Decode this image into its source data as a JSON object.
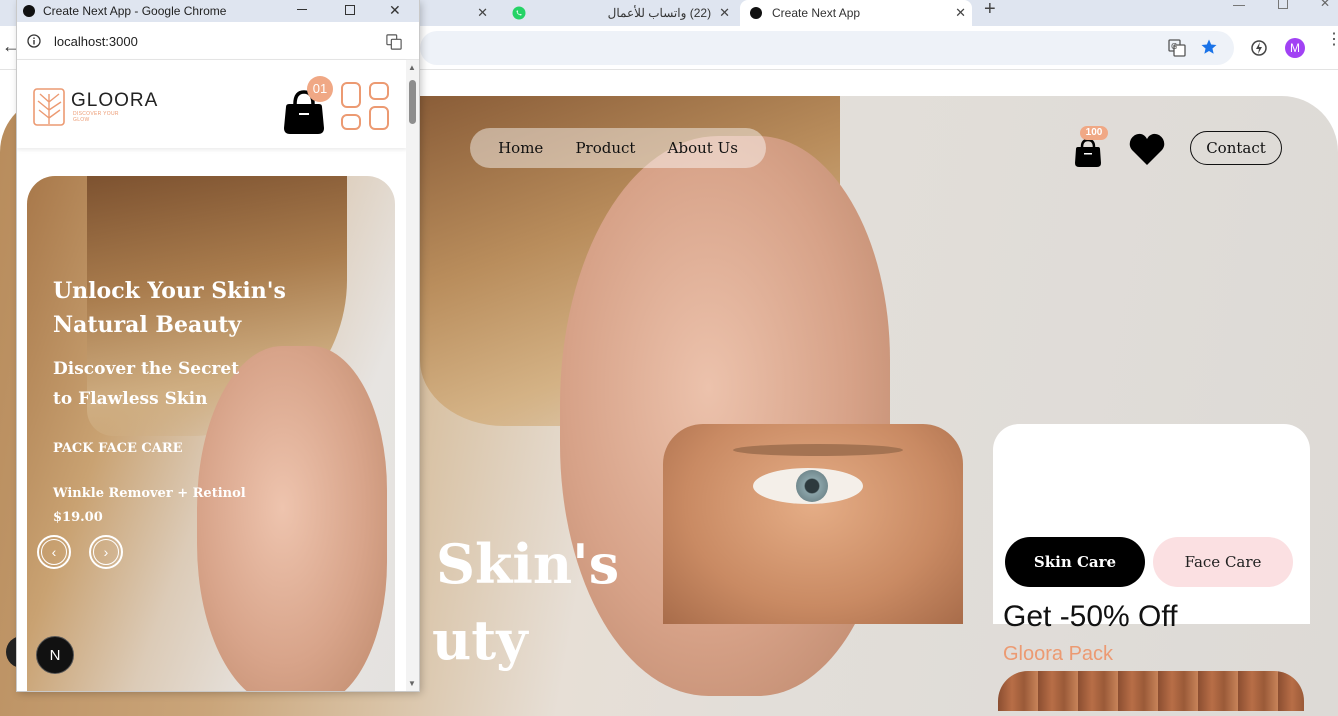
{
  "browser": {
    "tabs": [
      {
        "label": "(22) واتساب للأعمال"
      },
      {
        "label": "Create Next App"
      }
    ],
    "new_tab": "+",
    "profile_initial": "M"
  },
  "popup_window": {
    "title": "Create Next App - Google Chrome",
    "url": "localhost:3000",
    "logo_name": "GLOORA",
    "logo_tagline": "DISCOVER YOUR GLOW",
    "cart_count": "01",
    "slide": {
      "headline_line1": "Unlock Your Skin's",
      "headline_line2": "Natural Beauty",
      "subhead_line1": "Discover the Secret",
      "subhead_line2": "to Flawless Skin",
      "pack": "PACK FACE CARE",
      "product": "Winkle Remover + Retinol",
      "price": "$19.00"
    },
    "nextjs_badge": "N"
  },
  "main_page": {
    "nav": [
      "Home",
      "Product",
      "About Us"
    ],
    "cart_count": "100",
    "contact_label": "Contact",
    "hero_line1": "Skin's",
    "hero_line2": "uty",
    "offer": {
      "tab_active": "Skin Care",
      "tab_inactive": "Face Care",
      "title": "Get -50% Off",
      "subtitle": "Gloora Pack"
    }
  },
  "colors": {
    "accent_peach": "#ec9a72",
    "badge": "#f0a885",
    "pink_button": "#fbe0e2",
    "black": "#000000",
    "star_blue": "#1a73e8",
    "profile_purple": "#a142f4"
  },
  "icons": [
    "back-arrow-icon",
    "translate-icon",
    "star-icon",
    "extension-icon",
    "info-icon",
    "bag-icon",
    "heart-icon",
    "grid-menu-icon",
    "chevron-left-icon",
    "chevron-right-icon",
    "whatsapp-icon"
  ]
}
